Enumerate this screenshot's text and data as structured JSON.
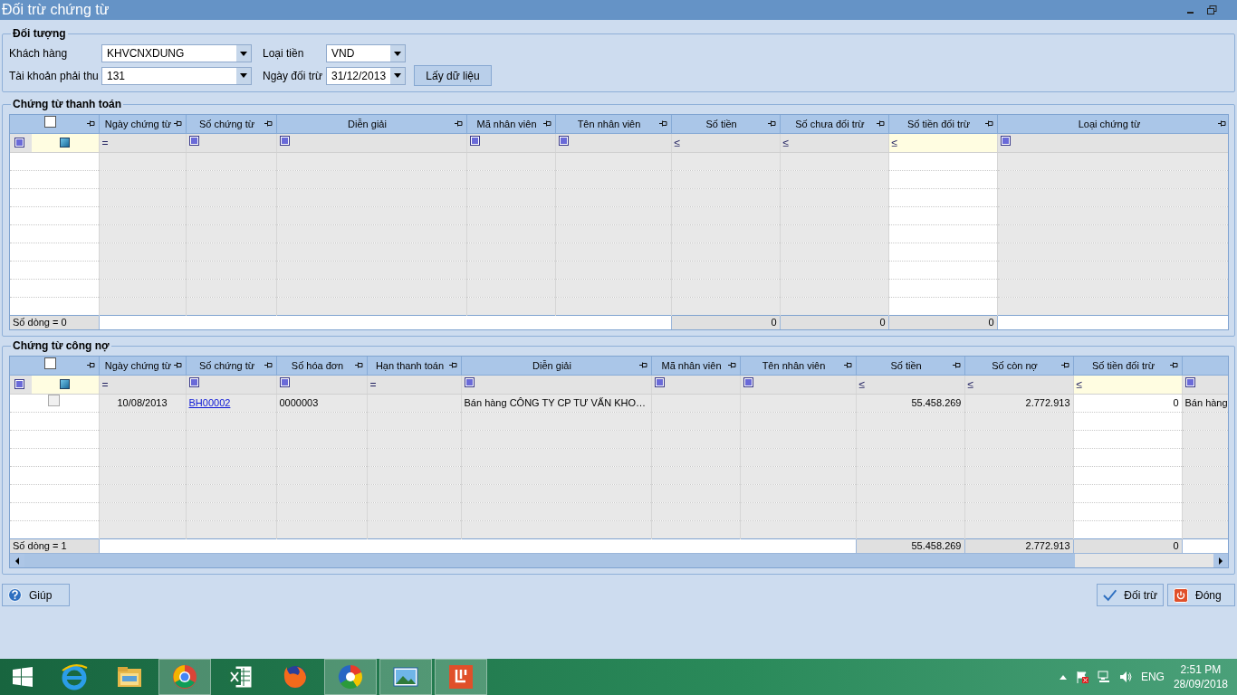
{
  "window": {
    "title": "Đối trừ chứng từ"
  },
  "criteria": {
    "title": "Đối tượng",
    "fields": [
      {
        "label": "Khách hàng",
        "value": "KHVCNXDUNG"
      },
      {
        "label": "Loại tiền",
        "value": "VND"
      },
      {
        "label": "Tài khoản phải thu",
        "value": "131"
      },
      {
        "label": "Ngày đối trừ",
        "value": "31/12/2013"
      }
    ],
    "fetch_button": "Lấy dữ liệu"
  },
  "payment_grid": {
    "title": "Chứng từ thanh toán",
    "select_all_checked": false,
    "columns": [
      {
        "kind": "check",
        "filter": {
          "kind": "selector"
        }
      },
      {
        "label": "Ngày chứng từ",
        "kind": "date",
        "filter": {
          "kind": "operator",
          "text": "="
        }
      },
      {
        "label": "Số chứng từ",
        "kind": "link",
        "filter": {
          "kind": "icon"
        }
      },
      {
        "label": "Diễn giải",
        "kind": "text",
        "filter": {
          "kind": "icon"
        }
      },
      {
        "label": "Mã nhân viên",
        "kind": "text",
        "filter": {
          "kind": "icon"
        }
      },
      {
        "label": "Tên nhân viên",
        "kind": "text",
        "filter": {
          "kind": "icon"
        }
      },
      {
        "label": "Số tiền",
        "kind": "number",
        "filter": {
          "kind": "operator",
          "text": "≤"
        },
        "total": "0"
      },
      {
        "label": "Số chưa đối trừ",
        "kind": "number",
        "filter": {
          "kind": "operator",
          "text": "≤"
        },
        "total": "0"
      },
      {
        "label": "Số tiền đối trừ",
        "kind": "number",
        "editable": true,
        "filter": {
          "kind": "operator",
          "text": "≤"
        },
        "total": "0"
      },
      {
        "label": "Loại chứng từ",
        "kind": "text",
        "filter": {
          "kind": "icon"
        }
      }
    ],
    "footer": {
      "label": "Số dòng = 0"
    }
  },
  "debt_grid": {
    "title": "Chứng từ công nợ",
    "select_all_checked": false,
    "columns": [
      {
        "kind": "check",
        "filter": {
          "kind": "selector"
        }
      },
      {
        "label": "Ngày chứng từ",
        "kind": "date",
        "filter": {
          "kind": "operator",
          "text": "="
        }
      },
      {
        "label": "Số chứng từ",
        "kind": "link",
        "filter": {
          "kind": "icon"
        }
      },
      {
        "label": "Số hóa đơn",
        "kind": "text",
        "filter": {
          "kind": "icon"
        }
      },
      {
        "label": "Hạn thanh toán",
        "kind": "date",
        "filter": {
          "kind": "operator",
          "text": "="
        }
      },
      {
        "label": "Diễn giải",
        "kind": "text",
        "filter": {
          "kind": "icon"
        }
      },
      {
        "label": "Mã nhân viên",
        "kind": "text",
        "filter": {
          "kind": "icon"
        }
      },
      {
        "label": "Tên nhân viên",
        "kind": "text",
        "filter": {
          "kind": "icon"
        }
      },
      {
        "label": "Số tiền",
        "kind": "number",
        "filter": {
          "kind": "operator",
          "text": "≤"
        },
        "total": "55.458.269"
      },
      {
        "label": "Số còn nợ",
        "kind": "number",
        "filter": {
          "kind": "operator",
          "text": "≤"
        },
        "total": "2.772.913"
      },
      {
        "label": "Số tiền đối trừ",
        "kind": "number",
        "editable": true,
        "filter": {
          "kind": "operator",
          "text": "≤"
        },
        "total": "0"
      },
      {
        "kind": "text",
        "filter": {
          "kind": "icon"
        }
      }
    ],
    "rows": [
      {
        "checked": false,
        "cells": [
          "",
          "10/08/2013",
          "BH00002",
          "0000003",
          "",
          "Bán hàng CÔNG TY CP TƯ VẤN KHO…",
          "",
          "",
          "55.458.269",
          "2.772.913",
          "0",
          "Bán hàng"
        ]
      }
    ],
    "footer": {
      "label": "Số dòng = 1"
    }
  },
  "buttons": {
    "help": "Giúp",
    "apply": "Đối trừ",
    "close": "Đóng"
  },
  "taskbar": {
    "apps": [
      {
        "kind": "browser",
        "active": false
      },
      {
        "kind": "folder",
        "active": false
      },
      {
        "kind": "circle",
        "active": true
      },
      {
        "kind": "spreadsheet",
        "active": false
      },
      {
        "kind": "fox",
        "active": false
      },
      {
        "kind": "pinwheel",
        "active": true
      },
      {
        "kind": "picture",
        "active": true
      },
      {
        "kind": "document",
        "active": true
      }
    ],
    "language": "ENG",
    "time": "2:51 PM",
    "date": "28/09/2018"
  }
}
